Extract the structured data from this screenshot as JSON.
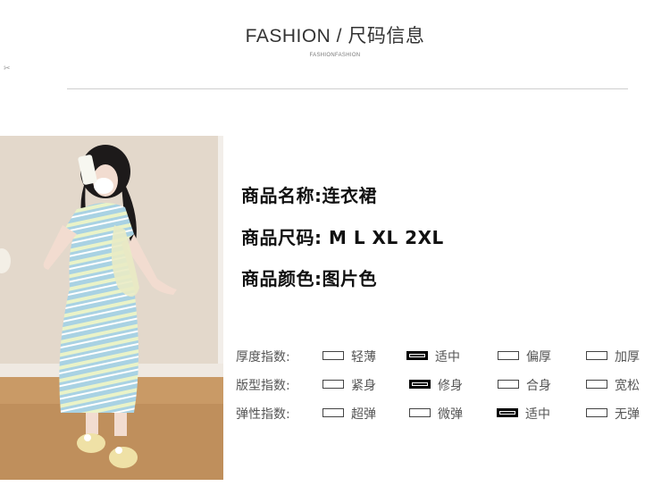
{
  "header": {
    "title": "FASHION / 尺码信息",
    "subtitle": "FASHIONFASHION"
  },
  "product": {
    "name_label": "商品名称:",
    "name_value": "连衣裙",
    "size_label": "商品尺码:",
    "size_value": " M L XL 2XL",
    "color_label": "商品颜色:",
    "color_value": "图片色"
  },
  "specs": [
    {
      "label": "厚度指数:",
      "options": [
        {
          "text": "轻薄",
          "selected": false
        },
        {
          "text": "适中",
          "selected": true
        },
        {
          "text": "偏厚",
          "selected": false
        },
        {
          "text": "加厚",
          "selected": false
        }
      ]
    },
    {
      "label": "版型指数:",
      "options": [
        {
          "text": "紧身",
          "selected": false
        },
        {
          "text": "修身",
          "selected": true
        },
        {
          "text": "合身",
          "selected": false
        },
        {
          "text": "宽松",
          "selected": false
        }
      ]
    },
    {
      "label": "弹性指数:",
      "options": [
        {
          "text": "超弹",
          "selected": false
        },
        {
          "text": "微弹",
          "selected": false
        },
        {
          "text": "适中",
          "selected": true
        },
        {
          "text": "无弹",
          "selected": false
        }
      ]
    }
  ]
}
